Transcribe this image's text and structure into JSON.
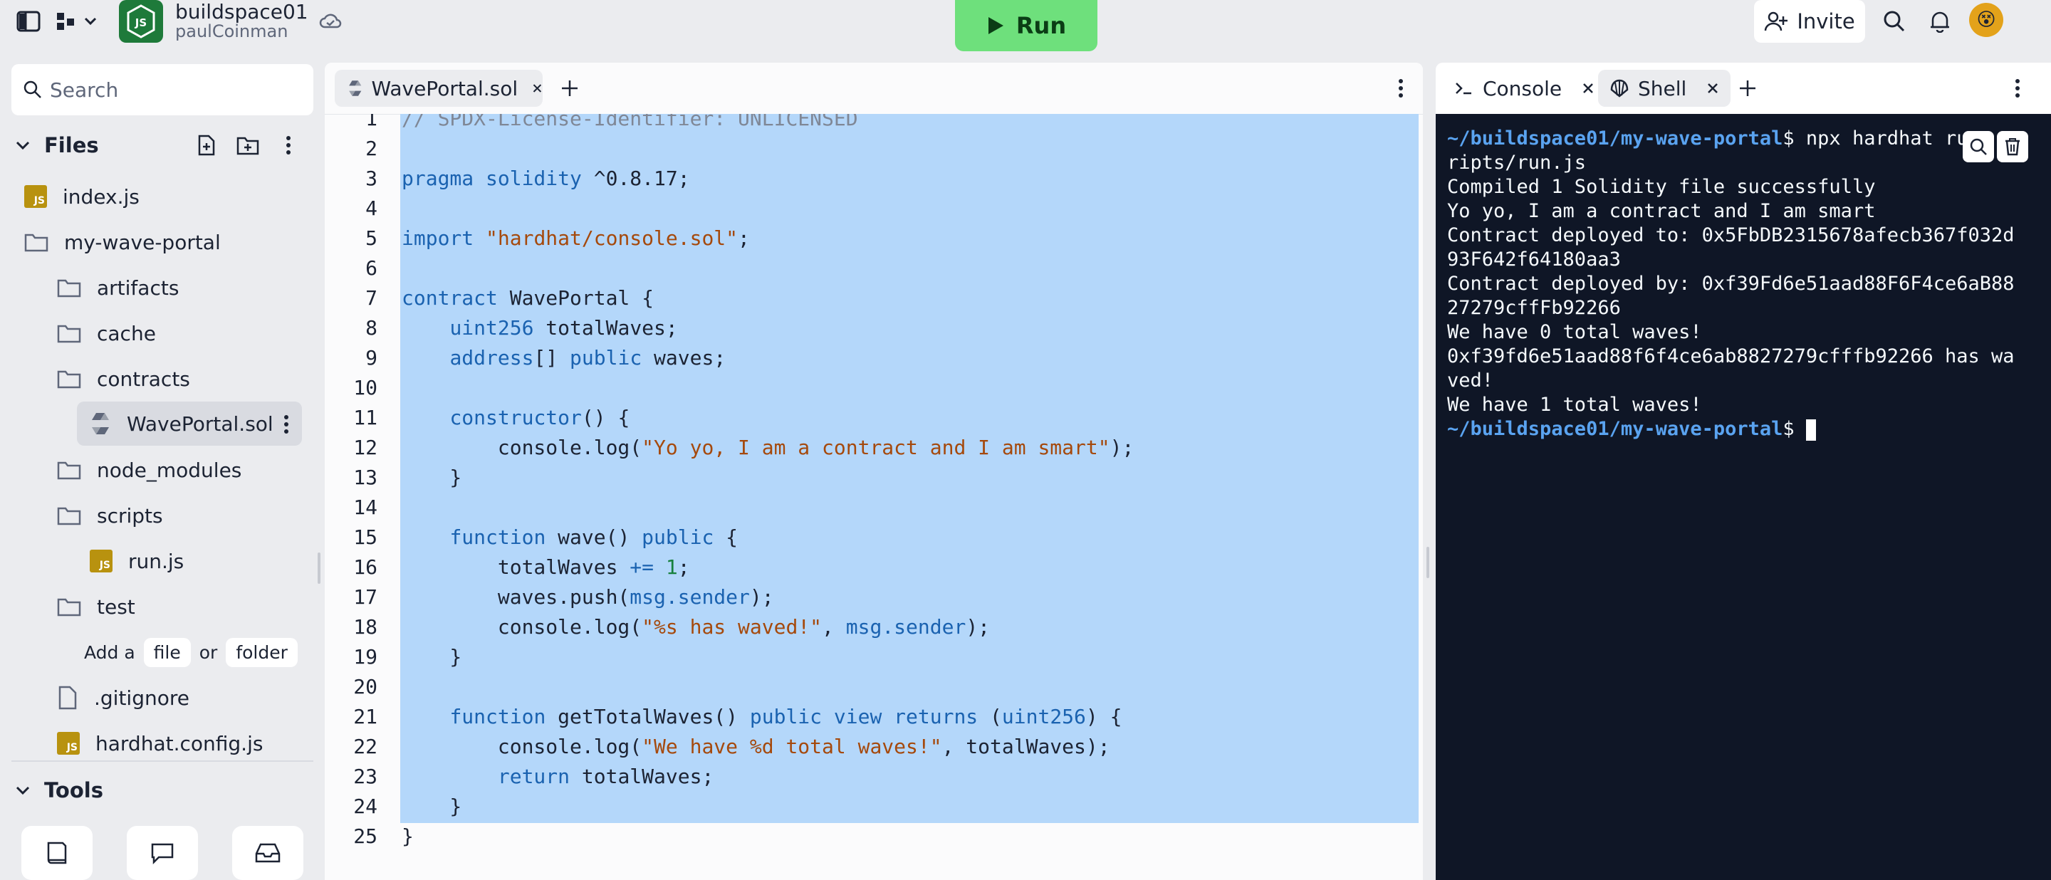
{
  "topbar": {
    "repo_name": "buildspace01",
    "repo_owner": "paulCoinman",
    "run_label": "Run",
    "invite_label": "Invite",
    "avatar_emoji": "😵"
  },
  "sidebar": {
    "search_placeholder": "Search",
    "files_label": "Files",
    "tools_label": "Tools",
    "tree": [
      {
        "name": "index.js",
        "type": "js"
      },
      {
        "name": "my-wave-portal",
        "type": "folder"
      },
      {
        "name": "artifacts",
        "type": "folder"
      },
      {
        "name": "cache",
        "type": "folder"
      },
      {
        "name": "contracts",
        "type": "folder"
      },
      {
        "name": "WavePortal.sol",
        "type": "sol"
      },
      {
        "name": "node_modules",
        "type": "folder"
      },
      {
        "name": "scripts",
        "type": "folder"
      },
      {
        "name": "run.js",
        "type": "js"
      },
      {
        "name": "test",
        "type": "folder"
      },
      {
        "name": ".gitignore",
        "type": "file"
      },
      {
        "name": "hardhat.config.js",
        "type": "js"
      }
    ],
    "add_hint": {
      "prefix": "Add a",
      "file": "file",
      "or": "or",
      "folder": "folder"
    }
  },
  "editor": {
    "tab_label": "WavePortal.sol"
  },
  "shell": {
    "console_tab": "Console",
    "shell_tab": "Shell",
    "prompt": "~/buildspace01/my-wave-portal",
    "command": "$ npx hardhat ru",
    "lines": [
      "ripts/run.js",
      "Compiled 1 Solidity file successfully",
      "Yo yo, I am a contract and I am smart",
      "Contract deployed to: 0x5FbDB2315678afecb367f032d",
      "93F642f64180aa3",
      "Contract deployed by: 0xf39Fd6e51aad88F6F4ce6aB88",
      "27279cffFb92266",
      "We have 0 total waves!",
      "0xf39fd6e51aad88f6f4ce6ab8827279cfffb92266 has wa",
      "ved!",
      "We have 1 total waves!"
    ],
    "last_prompt": "~/buildspace01/my-wave-portal",
    "last_prompt_suffix": "$ "
  }
}
